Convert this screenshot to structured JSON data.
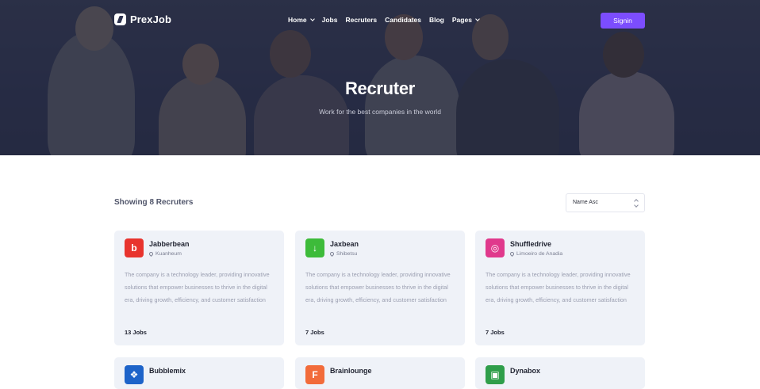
{
  "brand": {
    "name": "PrexJob"
  },
  "nav": {
    "items": [
      {
        "label": "Home",
        "dropdown": true
      },
      {
        "label": "Jobs",
        "dropdown": false
      },
      {
        "label": "Recruters",
        "dropdown": false
      },
      {
        "label": "Candidates",
        "dropdown": false
      },
      {
        "label": "Blog",
        "dropdown": false
      },
      {
        "label": "Pages",
        "dropdown": true
      }
    ],
    "signin_label": "Signin"
  },
  "hero": {
    "title": "Recruter",
    "subtitle": "Work for the best companies in the world"
  },
  "listing": {
    "showing_text": "Showing 8 Recruters",
    "sort_value": "Name Asc"
  },
  "colors": {
    "accent": "#7c4dff",
    "card_bg": "#eff2f8"
  },
  "companies": [
    {
      "name": "Jabberbean",
      "location": "Kuanheum",
      "description": "The company is a technology leader, providing innovative solutions that empower businesses to thrive in the digital era, driving growth, efficiency, and customer satisfaction",
      "jobs": "13 Jobs",
      "icon": "jabberbean-logo-icon",
      "logo_color": "#e8342e",
      "logo_glyph": "b"
    },
    {
      "name": "Jaxbean",
      "location": "Shibetsu",
      "description": "The company is a technology leader, providing innovative solutions that empower businesses to thrive in the digital era, driving growth, efficiency, and customer satisfaction",
      "jobs": "7 Jobs",
      "icon": "jaxbean-logo-icon",
      "logo_color": "#3dbb3a",
      "logo_glyph": "↓"
    },
    {
      "name": "Shuffledrive",
      "location": "Limoeiro de Anadia",
      "description": "The company is a technology leader, providing innovative solutions that empower businesses to thrive in the digital era, driving growth, efficiency, and customer satisfaction",
      "jobs": "7 Jobs",
      "icon": "shuffledrive-logo-icon",
      "logo_color": "#e0398c",
      "logo_glyph": "◎"
    },
    {
      "name": "Bubblemix",
      "icon": "bubblemix-logo-icon",
      "logo_color": "#1d63c9",
      "logo_glyph": "❖"
    },
    {
      "name": "Brainlounge",
      "icon": "brainlounge-logo-icon",
      "logo_color": "#f26b3a",
      "logo_glyph": "F"
    },
    {
      "name": "Dynabox",
      "icon": "dynabox-logo-icon",
      "logo_color": "#2f9e4a",
      "logo_glyph": "▣"
    }
  ]
}
